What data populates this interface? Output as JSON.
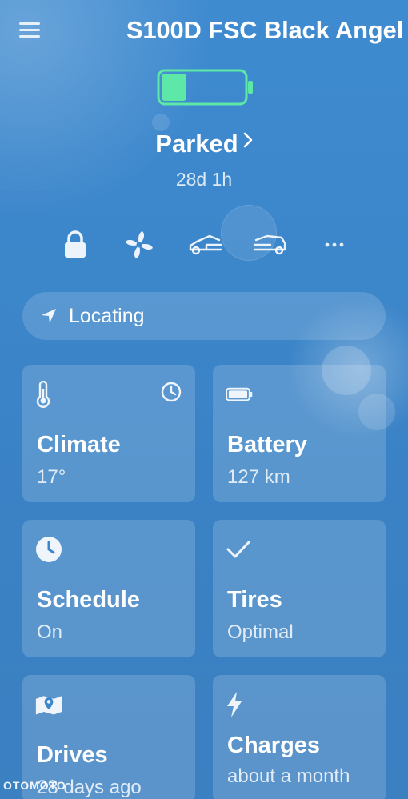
{
  "header": {
    "car_name": "S100D FSC Black Angel"
  },
  "battery": {
    "charge_level": 0.3
  },
  "status": {
    "label": "Parked",
    "duration": "28d 1h"
  },
  "quick_actions": [
    "lock-icon",
    "fan-icon",
    "frunk-icon",
    "trunk-icon",
    "more-icon"
  ],
  "location": {
    "label": "Locating"
  },
  "cards": {
    "climate": {
      "title": "Climate",
      "value": "17°"
    },
    "battery": {
      "title": "Battery",
      "value": "127 km"
    },
    "schedule": {
      "title": "Schedule",
      "value": "On"
    },
    "tires": {
      "title": "Tires",
      "value": "Optimal"
    },
    "drives": {
      "title": "Drives",
      "value": "28 days ago"
    },
    "charges": {
      "title": "Charges",
      "value": "about a month"
    }
  },
  "watermark": "OTOMOTO",
  "colors": {
    "battery_fill": "#5de8a7",
    "background": "#3c86ca"
  }
}
